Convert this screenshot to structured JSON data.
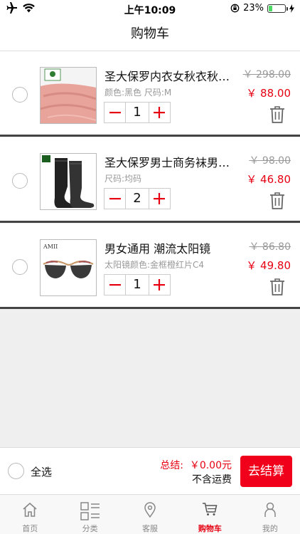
{
  "status_bar": {
    "time": "上午10:09",
    "battery": "23%",
    "battery_level": 0.23
  },
  "nav": {
    "title": "购物车"
  },
  "items": [
    {
      "name": "圣大保罗内衣女秋衣秋裤套装",
      "spec": "颜色:黑色 尺码:M",
      "qty": "1",
      "old_price": "￥ 298.00",
      "price": "￥ 88.00",
      "image": "pink-fabric-product-image"
    },
    {
      "name": "圣大保罗男士商务袜男士袜子",
      "spec": "尺码:均码",
      "qty": "2",
      "old_price": "￥ 98.00",
      "price": "￥ 46.80",
      "image": "black-socks-product-image"
    },
    {
      "name": "男女通用 潮流太阳镜",
      "spec": "太阳镜颜色:金框橙红片C4",
      "qty": "1",
      "old_price": "￥ 86.80",
      "price": "￥ 49.80",
      "image": "sunglasses-product-image",
      "brand_mark": "AMII"
    }
  ],
  "checkout": {
    "select_all": "全选",
    "total_label": "总结:",
    "total_value": "￥0.00元",
    "shipping_note": "不含运费",
    "checkout_label": "去结算"
  },
  "tabs": [
    {
      "label": "首页",
      "icon": "home-icon"
    },
    {
      "label": "分类",
      "icon": "category-icon"
    },
    {
      "label": "客服",
      "icon": "location-pin-icon"
    },
    {
      "label": "购物车",
      "icon": "cart-icon",
      "active": true
    },
    {
      "label": "我的",
      "icon": "person-icon"
    }
  ],
  "colors": {
    "accent": "#e60012",
    "checkout_button": "#f0001b",
    "background": "#efefef"
  }
}
